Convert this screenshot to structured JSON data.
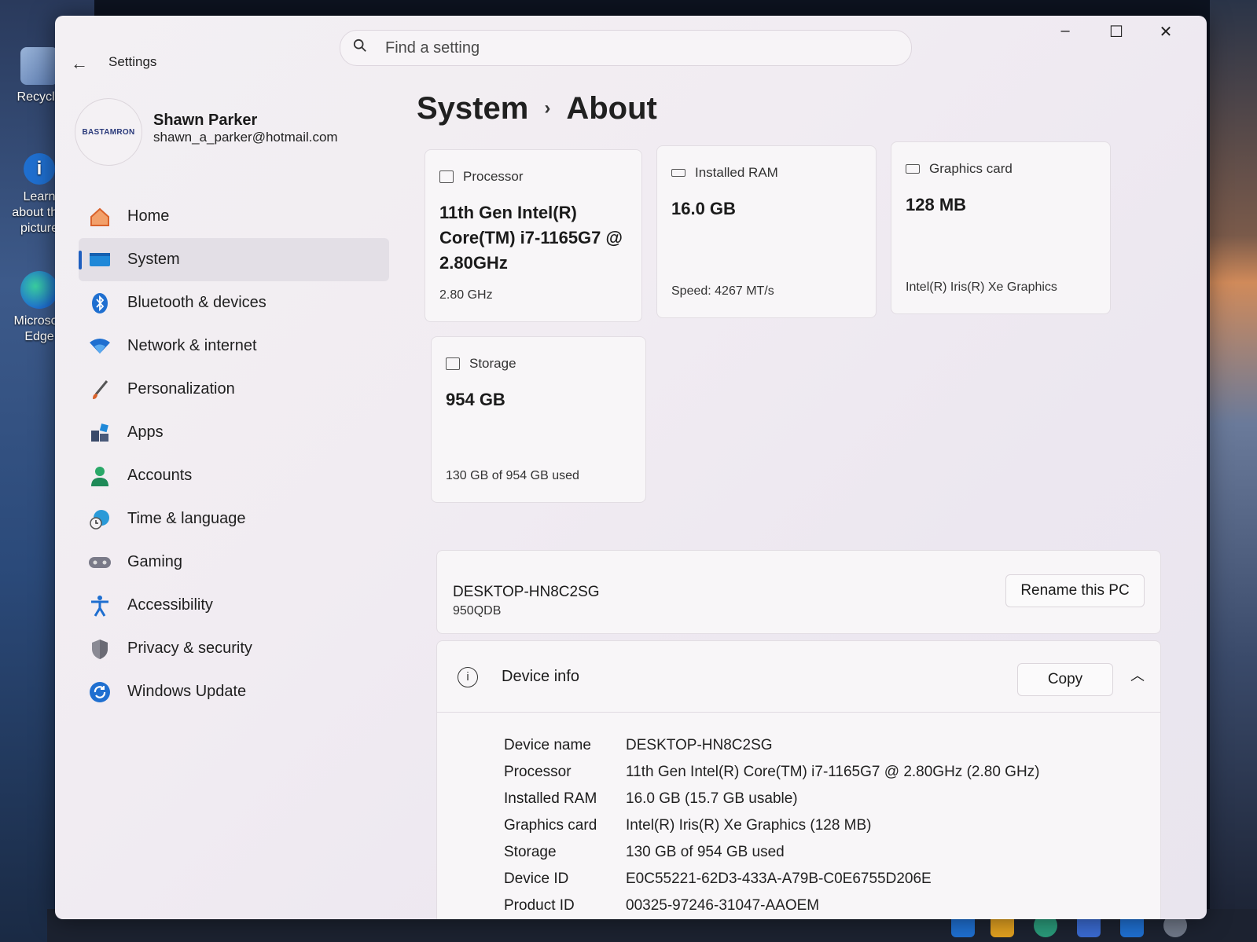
{
  "desktop": {
    "icons": [
      {
        "label": "Recycle",
        "icon": "recycle-bin-icon"
      },
      {
        "label": "Learn about this picture",
        "icon": "info-icon"
      },
      {
        "label": "Microsoft Edge",
        "icon": "edge-icon"
      }
    ]
  },
  "window": {
    "app_title": "Settings",
    "search_placeholder": "Find a setting"
  },
  "profile": {
    "name": "Shawn Parker",
    "email": "shawn_a_parker@hotmail.com",
    "avatar_text": "BASTAMRON"
  },
  "nav": {
    "items": [
      {
        "label": "Home",
        "icon": "home-icon",
        "color": "#d9622b"
      },
      {
        "label": "System",
        "icon": "system-icon",
        "color": "#1f78c8",
        "active": true
      },
      {
        "label": "Bluetooth & devices",
        "icon": "bluetooth-icon",
        "color": "#1f6fd0"
      },
      {
        "label": "Network & internet",
        "icon": "wifi-icon",
        "color": "#1f6fd0"
      },
      {
        "label": "Personalization",
        "icon": "brush-icon",
        "color": "#c0572a"
      },
      {
        "label": "Apps",
        "icon": "apps-icon",
        "color": "#3a5a8a"
      },
      {
        "label": "Accounts",
        "icon": "accounts-icon",
        "color": "#2a9a5a"
      },
      {
        "label": "Time & language",
        "icon": "globe-clock-icon",
        "color": "#1f8ad0"
      },
      {
        "label": "Gaming",
        "icon": "gamepad-icon",
        "color": "#606070"
      },
      {
        "label": "Accessibility",
        "icon": "accessibility-icon",
        "color": "#1f6fd0"
      },
      {
        "label": "Privacy & security",
        "icon": "shield-icon",
        "color": "#606070"
      },
      {
        "label": "Windows Update",
        "icon": "update-icon",
        "color": "#1f6fd0"
      }
    ]
  },
  "breadcrumb": {
    "parent": "System",
    "separator": "›",
    "current": "About"
  },
  "specs": {
    "processor": {
      "label": "Processor",
      "value": "11th Gen Intel(R) Core(TM) i7-1165G7 @ 2.80GHz",
      "sub": "2.80 GHz"
    },
    "ram": {
      "label": "Installed RAM",
      "value": "16.0 GB",
      "sub": "Speed: 4267 MT/s"
    },
    "graphics": {
      "label": "Graphics card",
      "value": "128 MB",
      "sub": "Intel(R) Iris(R) Xe Graphics"
    },
    "storage": {
      "label": "Storage",
      "value": "954 GB",
      "sub": "130 GB of 954 GB used"
    }
  },
  "pc": {
    "name": "DESKTOP-HN8C2SG",
    "model": "950QDB",
    "rename_label": "Rename this PC"
  },
  "device_info": {
    "title": "Device info",
    "copy_label": "Copy",
    "rows": [
      {
        "key": "Device name",
        "value": "DESKTOP-HN8C2SG"
      },
      {
        "key": "Processor",
        "value": "11th Gen Intel(R) Core(TM) i7-1165G7 @ 2.80GHz (2.80 GHz)"
      },
      {
        "key": "Installed RAM",
        "value": "16.0 GB (15.7 GB usable)"
      },
      {
        "key": "Graphics card",
        "value": "Intel(R) Iris(R) Xe Graphics (128 MB)"
      },
      {
        "key": "Storage",
        "value": "130 GB of 954 GB used"
      },
      {
        "key": "Device ID",
        "value": "E0C55221-62D3-433A-A79B-C0E6755D206E"
      },
      {
        "key": "Product ID",
        "value": "00325-97246-31047-AAOEM"
      }
    ]
  }
}
